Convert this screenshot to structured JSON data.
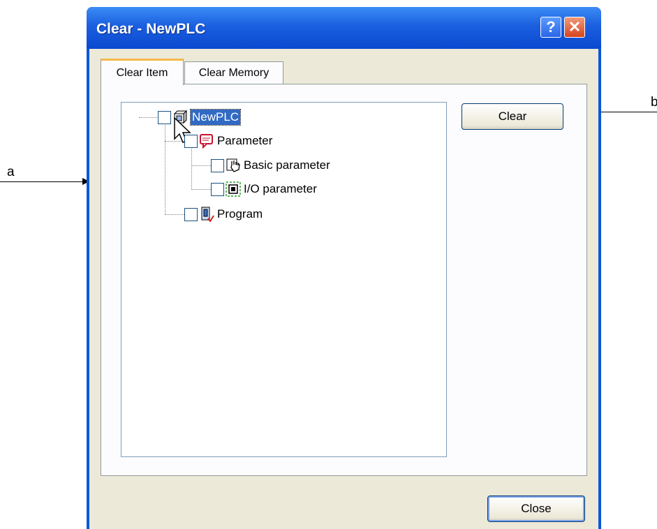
{
  "window": {
    "title": "Clear - NewPLC",
    "help_label": "?",
    "close_glyph": "✕"
  },
  "tabs": [
    {
      "label": "Clear Item",
      "active": true
    },
    {
      "label": "Clear Memory",
      "active": false
    }
  ],
  "tree": {
    "root": {
      "label": "NewPLC",
      "checked": false,
      "icon": "plc-icon",
      "selected": true
    },
    "children": [
      {
        "label": "Parameter",
        "checked": false,
        "icon": "parameter-icon",
        "children": [
          {
            "label": "Basic parameter",
            "checked": false,
            "icon": "basic-parameter-icon"
          },
          {
            "label": "I/O parameter",
            "checked": false,
            "icon": "io-parameter-icon"
          }
        ]
      },
      {
        "label": "Program",
        "checked": false,
        "icon": "program-icon"
      }
    ]
  },
  "buttons": {
    "clear": "Clear",
    "close": "Close"
  },
  "callouts": {
    "a": "a",
    "b": "b"
  },
  "colors": {
    "title_bar": "#0a49cf",
    "selection": "#316ac5",
    "dialog_bg": "#ece9d8",
    "active_tab_accent": "#f5b94a"
  }
}
